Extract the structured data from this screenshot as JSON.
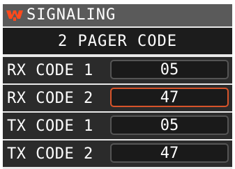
{
  "header": {
    "logo_icon": "yaesu-logo-icon",
    "title": "SIGNALING",
    "subtitle": "2 PAGER CODE"
  },
  "colors": {
    "title_bar": "#5a5a5a",
    "subtitle_bar": "#1c1c1c",
    "row_bg": "#2b2b2b",
    "logo": "#ff4a1c",
    "selected_border": "#d8542a"
  },
  "rows": [
    {
      "label": "RX CODE 1",
      "value": "05",
      "selected": false
    },
    {
      "label": "RX CODE 2",
      "value": "47",
      "selected": true
    },
    {
      "label": "TX CODE 1",
      "value": "05",
      "selected": false
    },
    {
      "label": "TX CODE 2",
      "value": "47",
      "selected": false
    }
  ]
}
